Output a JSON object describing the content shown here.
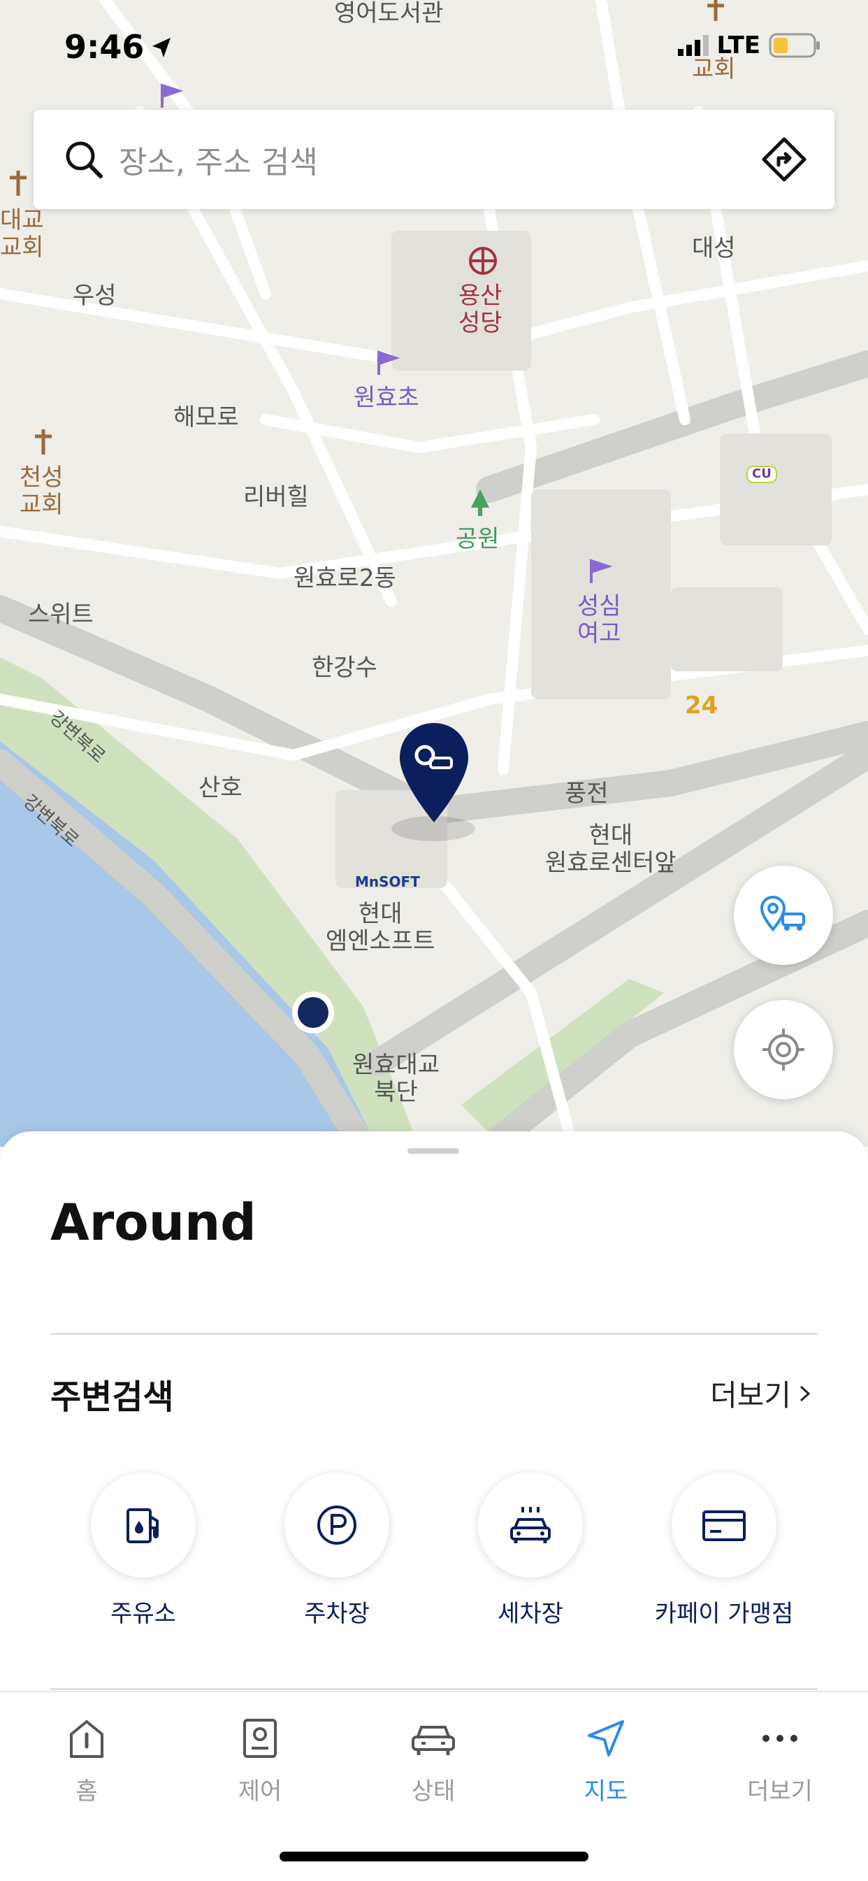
{
  "status_bar": {
    "time": "9:46",
    "network": "LTE"
  },
  "search": {
    "placeholder": "장소, 주소 검색"
  },
  "map": {
    "labels": {
      "library": "영어도서관",
      "church_top_right": "교회",
      "church_left": "대교\n교회",
      "usung": "우성",
      "yongsan_cathedral": "용산\n성당",
      "daesung": "대성",
      "wonhyo_elem": "원효초",
      "haemoro": "해모로",
      "riverhill": "리버힐",
      "cheonsung_church": "천성\n교회",
      "park": "공원",
      "wonhyoro2": "원효로2동",
      "sungsim": "성심\n여고",
      "suite": "스위트",
      "hangangsu": "한강수",
      "gangbyeon1": "강변북로",
      "gangbyeon2": "강변북로",
      "sanho": "산호",
      "pungjeon": "풍전",
      "hyundai_center": "현대\n원효로센터앞",
      "mnsoft": "MnSOFT",
      "hyundai_mnsoft": "현대\n엠엔소프트",
      "bridge_north": "원효대교\n북단",
      "cu": "CU",
      "emart24": "24"
    }
  },
  "sheet": {
    "title": "Around",
    "section_title": "주변검색",
    "more_label": "더보기",
    "categories": [
      {
        "label": "주유소",
        "icon": "fuel-icon"
      },
      {
        "label": "주차장",
        "icon": "parking-icon"
      },
      {
        "label": "세차장",
        "icon": "car-wash-icon"
      },
      {
        "label": "카페이 가맹점",
        "icon": "card-icon"
      }
    ]
  },
  "tabs": [
    {
      "label": "홈",
      "icon": "home-icon"
    },
    {
      "label": "제어",
      "icon": "control-icon"
    },
    {
      "label": "상태",
      "icon": "car-icon"
    },
    {
      "label": "지도",
      "icon": "navigation-icon"
    },
    {
      "label": "더보기",
      "icon": "more-icon"
    }
  ],
  "colors": {
    "accent": "#2b8be6",
    "navy": "#0b1f5c",
    "water": "#a8c7e6",
    "park": "#c7dfb4"
  }
}
